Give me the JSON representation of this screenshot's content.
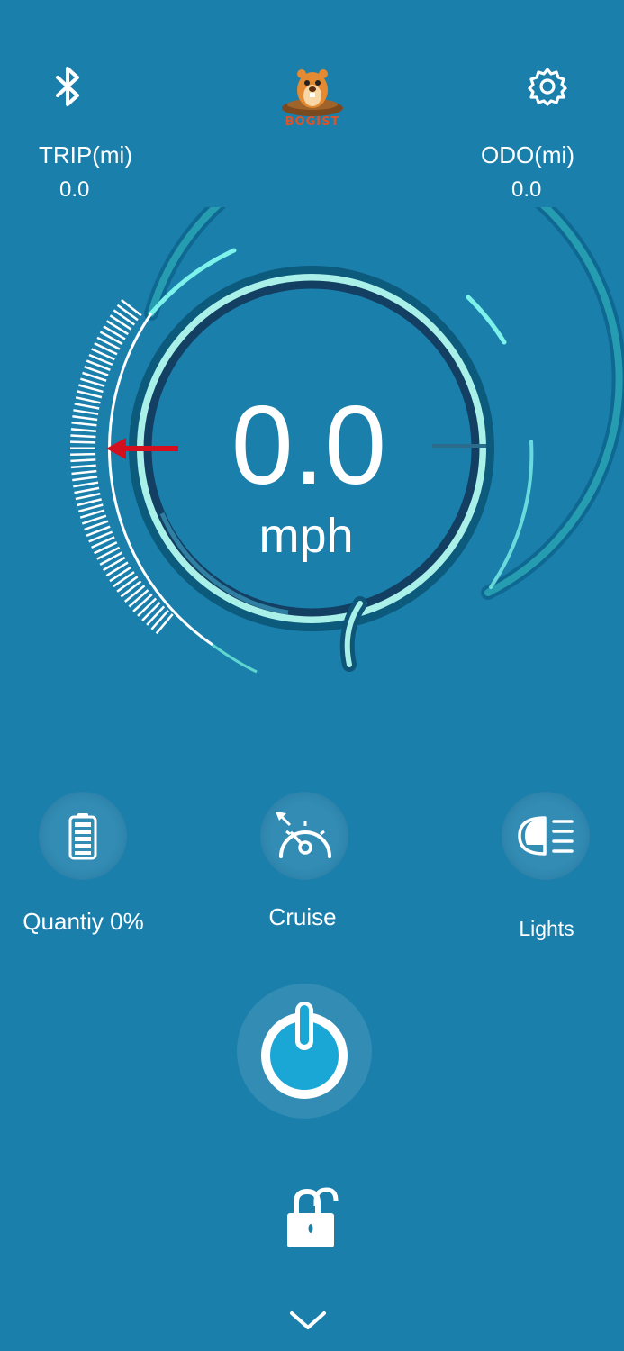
{
  "header": {
    "trip_label": "TRIP(mi)",
    "trip_value": "0.0",
    "odo_label": "ODO(mi)",
    "odo_value": "0.0",
    "logo_text": "BOGIST"
  },
  "speedometer": {
    "speed": "0.0",
    "unit": "mph"
  },
  "controls": {
    "battery_label": "Quantiy 0%",
    "battery_level": 0,
    "cruise_label": "Cruise",
    "lights_label": "Lights"
  },
  "icons": {
    "bluetooth": "bluetooth-icon",
    "settings": "gear-icon",
    "battery": "battery-icon",
    "cruise": "speedometer-icon",
    "lights": "headlight-icon",
    "power": "power-icon",
    "lock": "unlock-icon",
    "chevron": "chevron-down-icon"
  },
  "colors": {
    "background": "#1b7fac",
    "ring_accent": "#6fe6e0",
    "needle": "#d4101e",
    "power_fill": "#1aa7d6"
  }
}
